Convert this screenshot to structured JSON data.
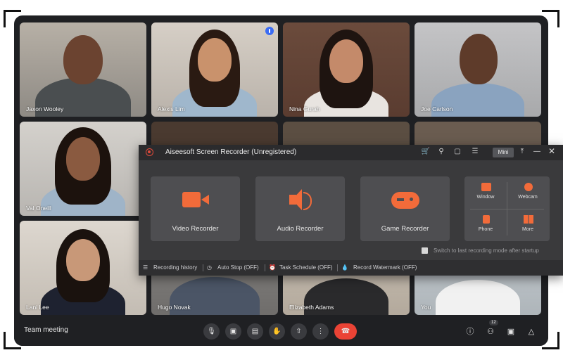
{
  "meeting": {
    "title": "Team meeting",
    "participants_badge": "12",
    "participants": [
      {
        "name": "Jaxon Wooley"
      },
      {
        "name": "Alexis Lim"
      },
      {
        "name": "Nina Gurah"
      },
      {
        "name": "Joe Carlson"
      },
      {
        "name": "Val Oneill"
      },
      {
        "name": "Lani Lee"
      },
      {
        "name": "Hugo Novak"
      },
      {
        "name": "Elizabeth Adams"
      },
      {
        "name": "You"
      }
    ],
    "controls": [
      "mic-icon",
      "camera-icon",
      "captions-icon",
      "raise-hand-icon",
      "present-icon",
      "more-icon",
      "end-call-icon"
    ],
    "right_icons": [
      "info-icon",
      "people-icon",
      "chat-icon",
      "activities-icon"
    ]
  },
  "recorder": {
    "title": "Aiseesoft Screen Recorder (Unregistered)",
    "mini_label": "Mini",
    "cards": [
      {
        "label": "Video Recorder",
        "icon": "video-camera-icon"
      },
      {
        "label": "Audio Recorder",
        "icon": "speaker-icon"
      },
      {
        "label": "Game Recorder",
        "icon": "gamepad-icon"
      }
    ],
    "grid": [
      {
        "label": "Window",
        "icon": "window-icon"
      },
      {
        "label": "Webcam",
        "icon": "webcam-icon"
      },
      {
        "label": "Phone",
        "icon": "phone-icon"
      },
      {
        "label": "More",
        "icon": "more-grid-icon"
      }
    ],
    "switch_label": "Switch to last recording mode after startup",
    "bottom": {
      "history": "Recording history",
      "auto_stop": "Auto Stop (OFF)",
      "task_schedule": "Task Schedule (OFF)",
      "watermark": "Record Watermark (OFF)"
    },
    "accent": "#f26b3a"
  }
}
